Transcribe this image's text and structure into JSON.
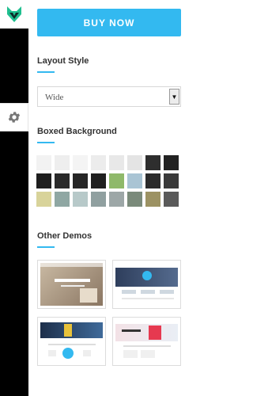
{
  "sidebar": {
    "logo_icon": "fox-logo-icon",
    "settings_icon": "gear-icon"
  },
  "panel": {
    "buy_label": "BUY NOW",
    "layout_style": {
      "title": "Layout Style",
      "selected": "Wide"
    },
    "boxed_background": {
      "title": "Boxed Background",
      "patterns": [
        "#f2f2f2",
        "#eeeeee",
        "#f4f4f4",
        "#ececec",
        "#e8e8e8",
        "#e4e4e4",
        "#2e2e2e",
        "#222222",
        "#1f1f1f",
        "#2a2a2a",
        "#262626",
        "#202020",
        "#8fb96a",
        "#a9c4d4",
        "#2b2b2b",
        "#3a3a3a",
        "#d8d39a",
        "#8fa7a3",
        "#b7c9c9",
        "#90a0a0",
        "#9da7a7",
        "#7a8a7a",
        "#9c9263",
        "#5a5a5a"
      ]
    },
    "other_demos": {
      "title": "Other Demos",
      "thumbnails": [
        "demo-1",
        "demo-2",
        "demo-3",
        "demo-4"
      ]
    }
  },
  "colors": {
    "accent": "#33b9f0",
    "rail": "#000000"
  }
}
